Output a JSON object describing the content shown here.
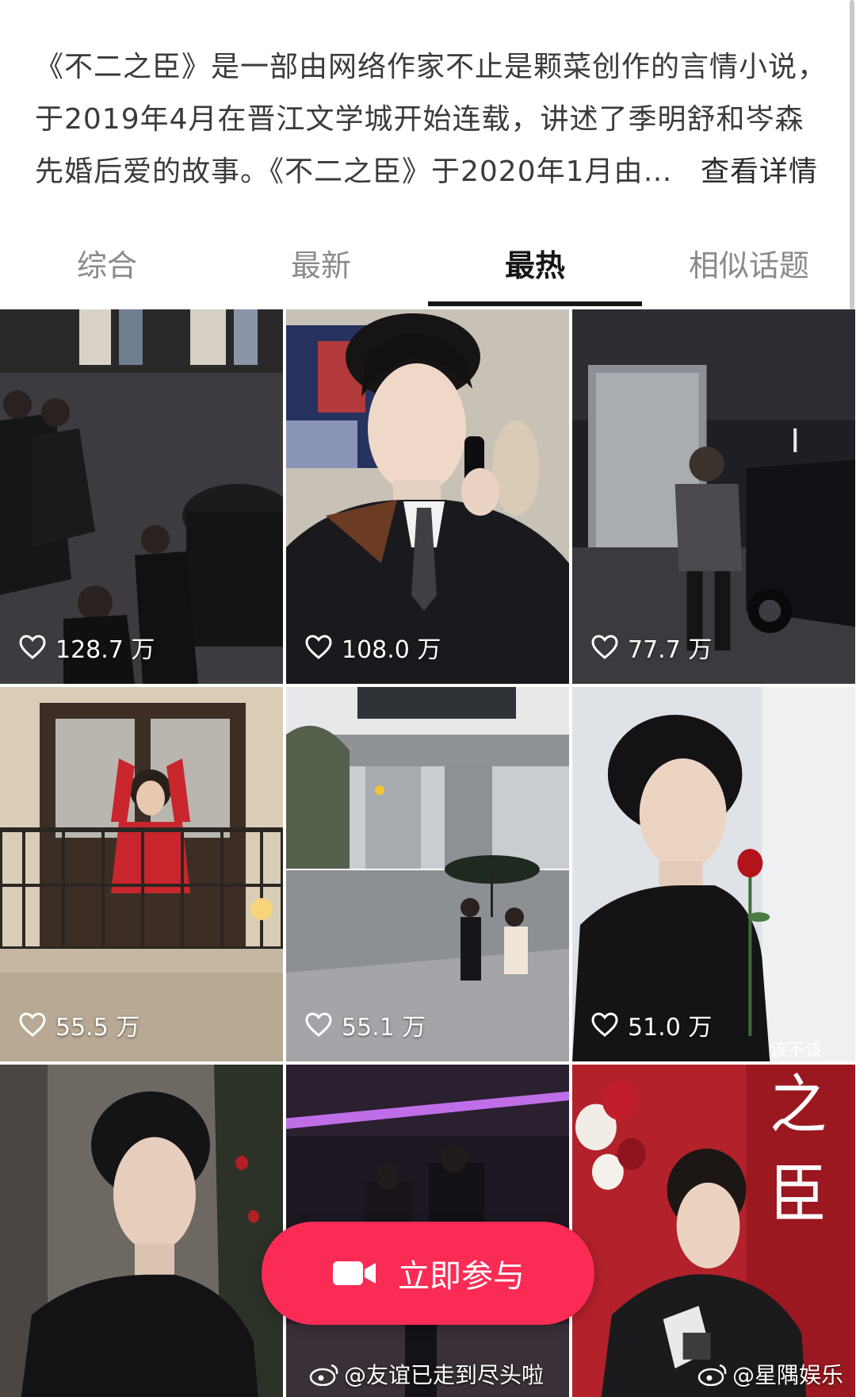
{
  "intro": {
    "lines": [
      "《不二之臣》是一部由网络作家不止是颗菜创作的言情小说，",
      "于2019年4月在晋江文学城开始连载，讲述了季明舒和岑森",
      "先婚后爱的故事。《不二之臣》于2020年1月由…"
    ],
    "more_label": "查看详情"
  },
  "tabs": [
    {
      "label": "综合",
      "active": false
    },
    {
      "label": "最新",
      "active": false
    },
    {
      "label": "最热",
      "active": true
    },
    {
      "label": "相似话题",
      "active": false
    }
  ],
  "videos": [
    {
      "likes": "128.7 万",
      "scene": "event-audience"
    },
    {
      "likes": "108.0 万",
      "scene": "phone-portrait"
    },
    {
      "likes": "77.7 万",
      "scene": "night-set"
    },
    {
      "likes": "55.5 万",
      "scene": "balcony-heart"
    },
    {
      "likes": "55.1 万",
      "scene": "street-crossing"
    },
    {
      "likes": "51.0 万",
      "scene": "rose-portrait"
    },
    {
      "likes": "",
      "scene": "black-coat"
    },
    {
      "likes": "",
      "scene": "purple-room"
    },
    {
      "likes": "",
      "scene": "red-backdrop"
    }
  ],
  "tile_text": {
    "rose_caption": "该不该",
    "backdrop_chars": [
      "之",
      "臣"
    ]
  },
  "join_button": {
    "label": "立即参与",
    "color": "#fa2c55"
  },
  "watermarks": {
    "left": "@友谊已走到尽头啦",
    "right": "@星隅娱乐"
  }
}
